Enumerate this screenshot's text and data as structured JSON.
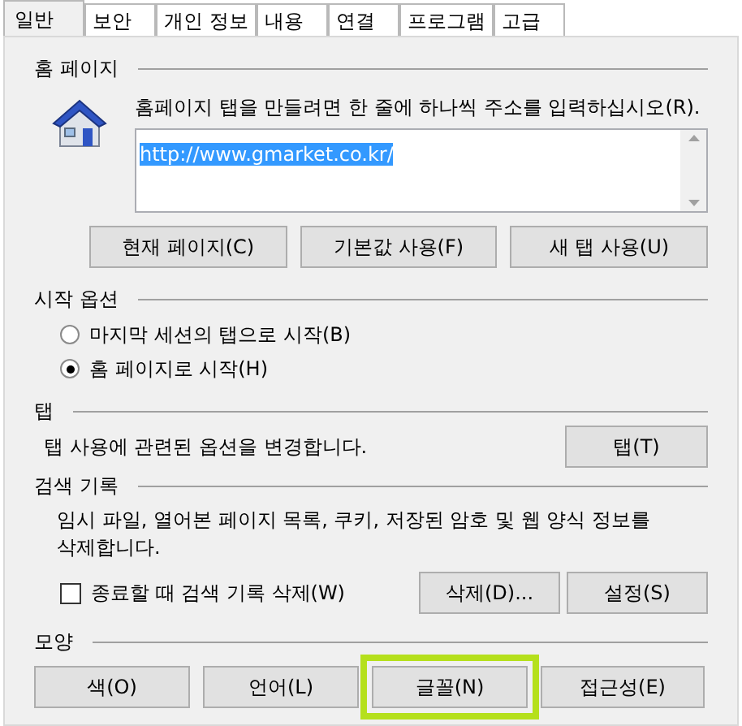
{
  "tabs": [
    {
      "label": "일반",
      "selected": true
    },
    {
      "label": "보안",
      "selected": false
    },
    {
      "label": "개인 정보",
      "selected": false
    },
    {
      "label": "내용",
      "selected": false
    },
    {
      "label": "연결",
      "selected": false
    },
    {
      "label": "프로그램",
      "selected": false
    },
    {
      "label": "고급",
      "selected": false
    }
  ],
  "home_page": {
    "title": "홈 페이지",
    "instruction": "홈페이지 탭을 만들려면 한 줄에 하나씩 주소를 입력하십시오(R).",
    "value": "http://www.gmarket.co.kr/",
    "buttons": [
      "현재 페이지(C)",
      "기본값 사용(F)",
      "새 탭 사용(U)"
    ]
  },
  "startup": {
    "title": "시작 옵션",
    "options": [
      {
        "label": "마지막 세션의 탭으로 시작(B)",
        "selected": false
      },
      {
        "label": "홈 페이지로 시작(H)",
        "selected": true
      }
    ]
  },
  "tabs_section": {
    "title": "탭",
    "description": "탭 사용에 관련된 옵션을 변경합니다.",
    "button": "탭(T)"
  },
  "history": {
    "title": "검색 기록",
    "description": "임시 파일, 열어본 페이지 목록, 쿠키, 저장된 암호 및 웹 양식 정보를 삭제합니다.",
    "checkbox": {
      "label": "종료할 때 검색 기록 삭제(W)",
      "checked": false
    },
    "buttons": [
      "삭제(D)...",
      "설정(S)"
    ]
  },
  "appearance": {
    "title": "모양",
    "buttons": [
      {
        "label": "색(O)",
        "highlighted": false
      },
      {
        "label": "언어(L)",
        "highlighted": false
      },
      {
        "label": "글꼴(N)",
        "highlighted": true
      },
      {
        "label": "접근성(E)",
        "highlighted": false
      }
    ]
  }
}
